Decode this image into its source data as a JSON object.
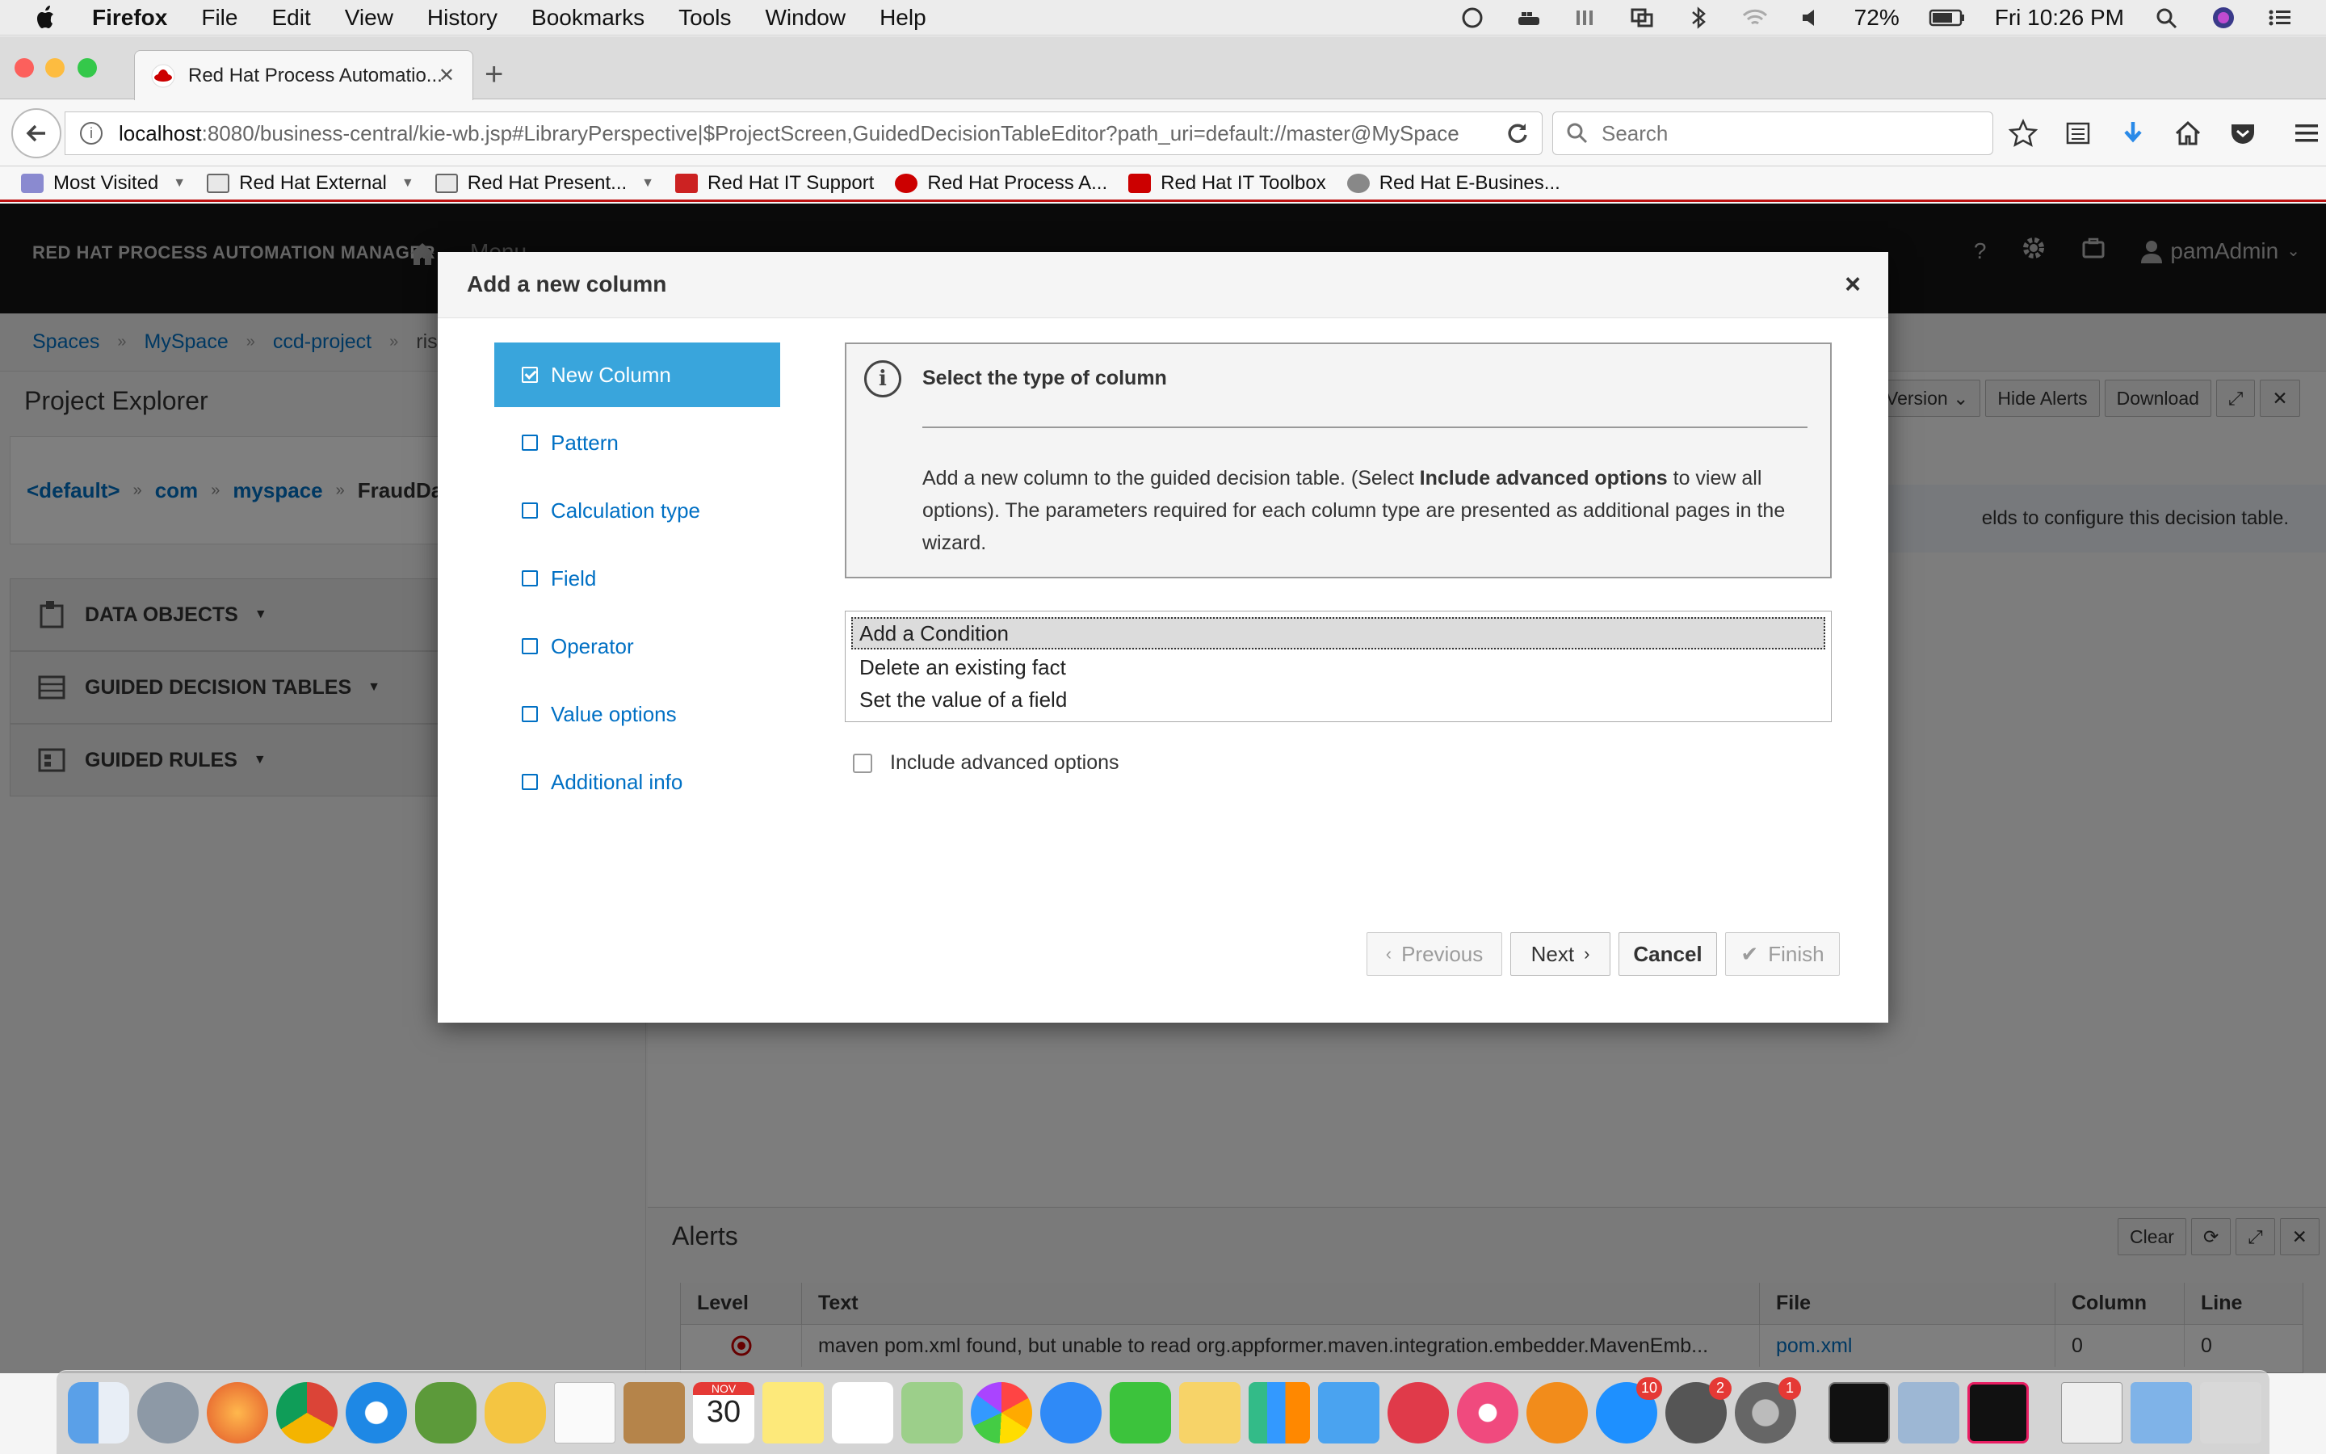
{
  "menubar": {
    "app": "Firefox",
    "items": [
      "File",
      "Edit",
      "View",
      "History",
      "Bookmarks",
      "Tools",
      "Window",
      "Help"
    ],
    "battery": "72%",
    "clock": "Fri 10:26 PM"
  },
  "browser": {
    "tab_title": "Red Hat Process Automatio...",
    "url_host": "localhost",
    "url_rest": ":8080/business-central/kie-wb.jsp#LibraryPerspective|$ProjectScreen,GuidedDecisionTableEditor?path_uri=default://master@MySpace",
    "search_placeholder": "Search",
    "bookmarks": [
      "Most Visited",
      "Red Hat External",
      "Red Hat Present...",
      "Red Hat IT Support",
      "Red Hat Process A...",
      "Red Hat IT Toolbox",
      "Red Hat E-Busines..."
    ]
  },
  "app": {
    "brand": "RED HAT PROCESS AUTOMATION MANAGER",
    "menu_label": "Menu",
    "user": "pamAdmin",
    "breadcrumbs": [
      "Spaces",
      "MySpace",
      "ccd-project",
      "ris"
    ],
    "project_explorer": {
      "title": "Project Explorer",
      "path": [
        "<default>",
        "com",
        "myspace"
      ],
      "path_current": "FraudDa",
      "sections": [
        "DATA OBJECTS",
        "GUIDED DECISION TABLES",
        "GUIDED RULES"
      ]
    },
    "toolbar": {
      "version": "Version",
      "hide_alerts": "Hide Alerts",
      "download": "Download"
    },
    "banner_text": "elds to configure this decision table.",
    "alerts": {
      "title": "Alerts",
      "clear": "Clear",
      "columns": [
        "Level",
        "Text",
        "File",
        "Column",
        "Line"
      ],
      "rows": [
        {
          "text": "maven pom.xml found, but unable to read org.appformer.maven.integration.embedder.MavenEmb...",
          "file": "pom.xml",
          "column": "0",
          "line": "0"
        }
      ]
    }
  },
  "modal": {
    "title": "Add a new column",
    "steps": [
      "New Column",
      "Pattern",
      "Calculation type",
      "Field",
      "Operator",
      "Value options",
      "Additional info"
    ],
    "active_step": "New Column",
    "info_title": "Select the type of column",
    "info_text_1": "Add a new column to the guided decision table. (Select ",
    "info_text_bold": "Include advanced options",
    "info_text_2": " to view all options). The parameters required for each column type are presented as additional pages in the wizard.",
    "column_types": [
      "Add a Condition",
      "Delete an existing fact",
      "Set the value of a field"
    ],
    "selected_type": "Add a Condition",
    "advanced_label": "Include advanced options",
    "advanced_checked": false,
    "buttons": {
      "previous": "Previous",
      "next": "Next",
      "cancel": "Cancel",
      "finish": "Finish"
    }
  },
  "dock": {
    "calendar_month": "NOV",
    "calendar_day": "30",
    "badges": {
      "app_store": "10",
      "mail": "2",
      "prefs": "1"
    }
  },
  "colors": {
    "accent": "#39a5dc",
    "link": "#0070c4",
    "header": "#151515",
    "danger": "#cc0000"
  }
}
